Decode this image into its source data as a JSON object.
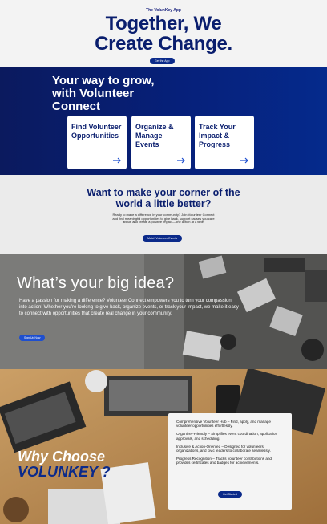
{
  "hero": {
    "eyebrow": "The VolunKey App",
    "headline": "Together, We Create Change.",
    "button": "Get the App"
  },
  "grow": {
    "headline": "Your way to grow, with Volunteer Connect",
    "cards": [
      {
        "title": "Find Volunteer Opportunities",
        "icon": "arrow-right-icon"
      },
      {
        "title": "Organize & Manage Events",
        "icon": "arrow-right-icon"
      },
      {
        "title": "Track Your Impact & Progress",
        "icon": "arrow-right-icon"
      }
    ]
  },
  "better": {
    "headline": "Want to make your corner of the world a little better?",
    "body": "Ready to make a difference in your community? Join Volunteer Connect and find meaningful opportunities to give back, support causes you care about, and create a positive impact—one action at a time!",
    "button": "Match Volunteer Events"
  },
  "idea": {
    "headline": "What’s your big idea?",
    "body": "Have a passion for making a difference? Volunteer Connect empowers you to turn your compassion into action! Whether you’re looking to give back, organize events, or track your impact, we make it easy to connect with opportunities that create real change in your community.",
    "button": "Sign Up Now"
  },
  "why": {
    "title_line1": "Why Choose",
    "title_line2": "VOLUNKEY ?",
    "features": [
      "Comprehensive Volunteer Hub – Find, apply, and manage volunteer opportunities effortlessly.",
      "Organizer-Friendly – Simplifies event coordination, application approvals, and scheduling.",
      "Inclusive & Action-Oriented – Designed for volunteers, organizations, and civic leaders to collaborate seamlessly.",
      "Progress Recognition – Tracks volunteer contributions and provides certificates and badges for achievements."
    ],
    "button": "Get Started"
  },
  "colors": {
    "navy": "#0a1e6e",
    "accent": "#1e4fcf",
    "band": "#06207a"
  }
}
